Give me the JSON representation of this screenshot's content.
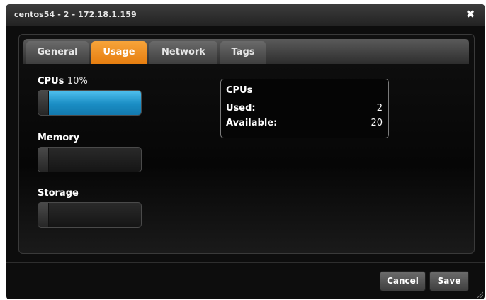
{
  "window": {
    "title": "centos54 - 2 - 172.18.1.159",
    "close_glyph": "✖"
  },
  "tabs": [
    {
      "label": "General",
      "active": false
    },
    {
      "label": "Usage",
      "active": true
    },
    {
      "label": "Network",
      "active": false
    },
    {
      "label": "Tags",
      "active": false
    }
  ],
  "usage": {
    "cpus": {
      "label": "CPUs",
      "percent_text": "10%",
      "fill_fraction": 1.0
    },
    "memory": {
      "label": "Memory",
      "fill_fraction": 0
    },
    "storage": {
      "label": "Storage",
      "fill_fraction": 0
    }
  },
  "info_box": {
    "title": "CPUs",
    "rows": [
      {
        "key": "Used:",
        "value": "2"
      },
      {
        "key": "Available:",
        "value": "20"
      }
    ]
  },
  "footer": {
    "cancel_label": "Cancel",
    "save_label": "Save"
  },
  "colors": {
    "active_tab": "#f39a2c",
    "cpu_bar": "#1a8dc4",
    "background": "#0d0d0d"
  }
}
